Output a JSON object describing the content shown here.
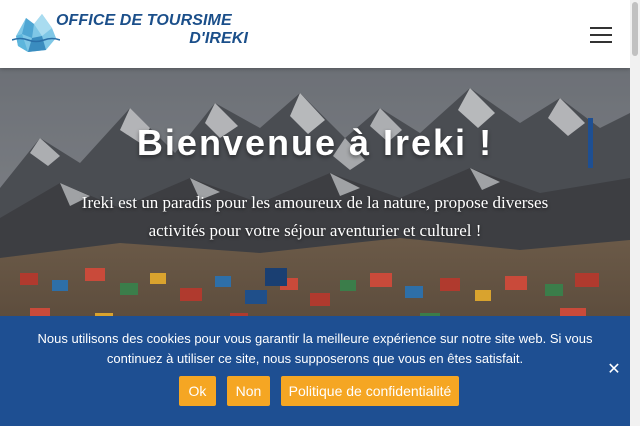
{
  "header": {
    "brand_line1": "OFFICE DE TOURSIME",
    "brand_line2": "D'IREKI",
    "logo_icon": "iceberg-logo",
    "menu_icon": "hamburger-menu-icon"
  },
  "hero": {
    "title": "Bienvenue à Ireki !",
    "text_line1": "Ireki est un paradis pour les amoureux de la nature, propose diverses",
    "text_line2": "activités pour votre séjour aventurier et culturel !",
    "background": "snowy mountains above a village of colorful houses"
  },
  "cookie_banner": {
    "message_line1": "Nous utilisons des cookies pour vous garantir la meilleure expérience sur notre site web. Si vous",
    "message_line2": "continuez à utiliser ce site, nous supposerons que vous en êtes satisfait.",
    "ok_label": "Ok",
    "no_label": "Non",
    "policy_label": "Politique de confidentialité",
    "close_label": "✕"
  },
  "colors": {
    "brand_blue": "#1b4f8a",
    "banner_blue": "#1e4f92",
    "button_orange": "#f5a623"
  }
}
